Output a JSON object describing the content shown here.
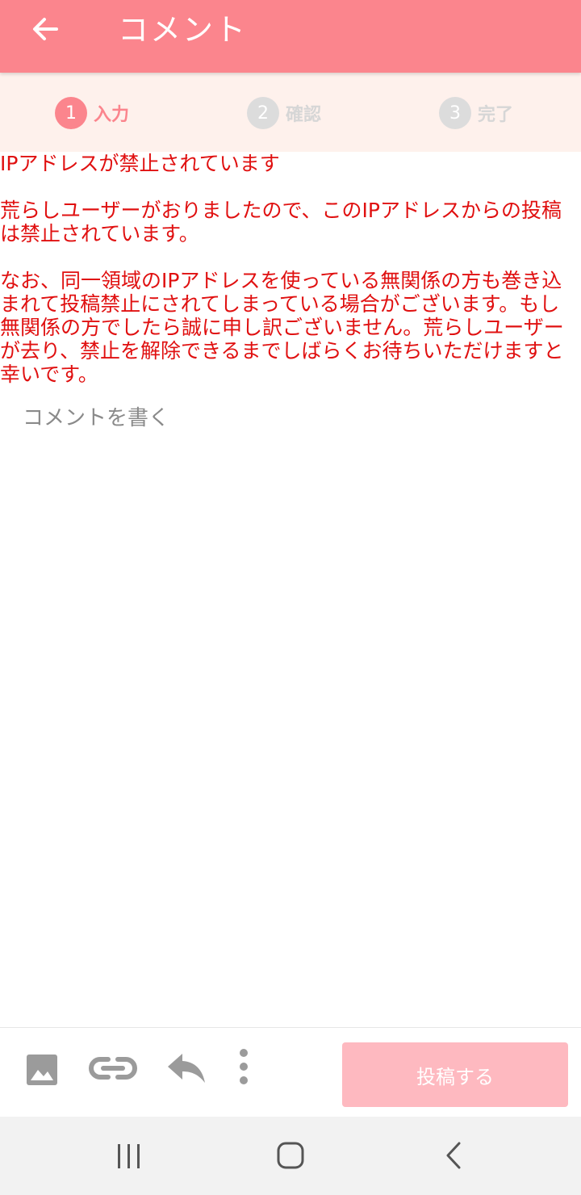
{
  "header": {
    "title": "コメント",
    "back_icon": "arrow-left-icon",
    "background_color": "#fb858d"
  },
  "steps": [
    {
      "number": "1",
      "label": "入力",
      "active": true
    },
    {
      "number": "2",
      "label": "確認",
      "active": false
    },
    {
      "number": "3",
      "label": "完了",
      "active": false
    }
  ],
  "notice": {
    "color": "#e01010",
    "heading": "IPアドレスが禁止されています",
    "paragraph1": "荒らしユーザーがおりましたので、このIPアドレスからの投稿は禁止されています。",
    "paragraph2": "なお、同一領域のIPアドレスを使っている無関係の方も巻き込まれて投稿禁止にされてしまっている場合がございます。もし無関係の方でしたら誠に申し訳ございません。荒らしユーザーが去り、禁止を解除できるまでしばらくお待ちいただけますと幸いです。"
  },
  "comment": {
    "placeholder": "コメントを書く",
    "value": ""
  },
  "toolbar": {
    "icons": [
      "image-icon",
      "link-icon",
      "reply-icon",
      "more-vertical-icon"
    ],
    "post_label": "投稿する",
    "post_color": "#feb9c0"
  },
  "navbar": {
    "icons": [
      "recent-apps-icon",
      "home-icon",
      "back-icon"
    ]
  }
}
